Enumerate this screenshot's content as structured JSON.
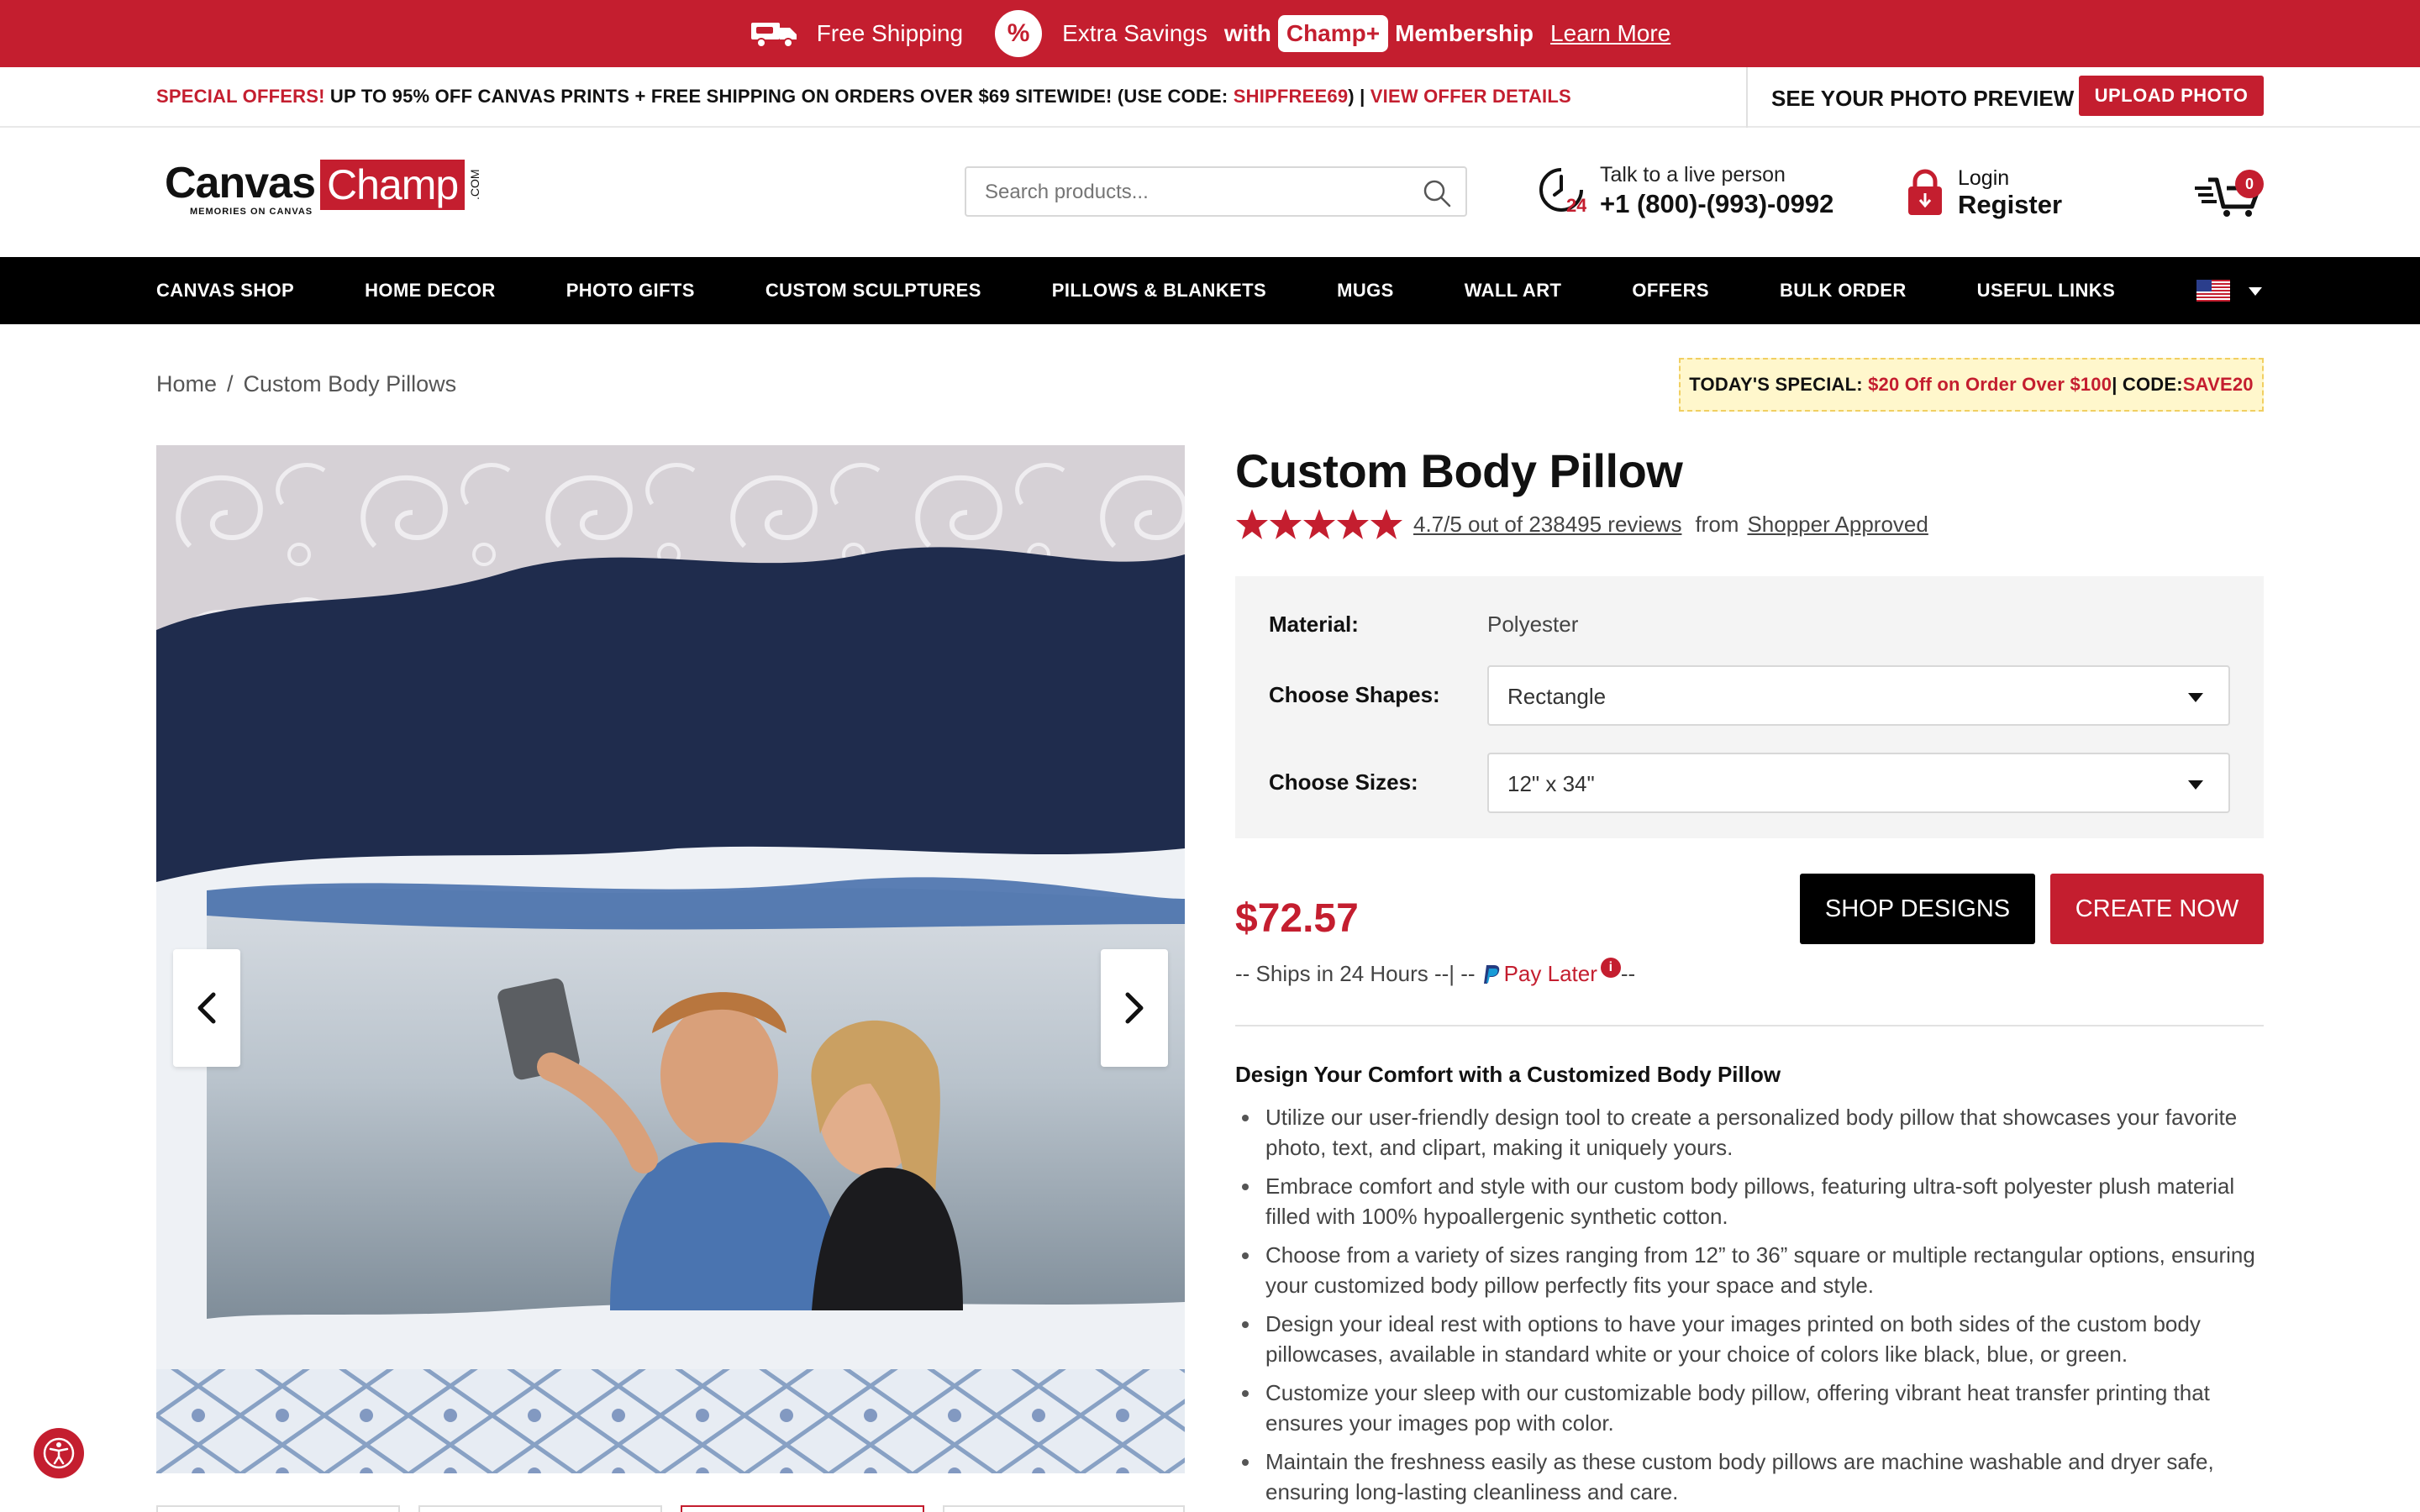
{
  "promo": {
    "free_shipping": "Free Shipping",
    "extra_savings": "Extra Savings",
    "with": "with",
    "champ_plus": "Champ+",
    "membership": "Membership",
    "learn_more": "Learn More",
    "percent_symbol": "%"
  },
  "offers": {
    "special_label": "SPECIAL OFFERS!",
    "text": " UP TO 95% OFF CANVAS PRINTS + FREE SHIPPING ON ORDERS OVER $69 SITEWIDE! (USE CODE: ",
    "code": "SHIPFREE69",
    "close_paren": ") | ",
    "view_details": "VIEW OFFER DETAILS",
    "preview": "SEE YOUR PHOTO PREVIEW",
    "upload": "UPLOAD PHOTO"
  },
  "header": {
    "logo_canvas": "Canvas",
    "logo_champ": "Champ",
    "logo_com": ".COM",
    "logo_tagline": "MEMORIES ON CANVAS",
    "search_placeholder": "Search products...",
    "phone_label": "Talk to a live person",
    "phone_number": "+1 (800)-(993)-0992",
    "phone_badge": "24",
    "login": "Login",
    "register": "Register",
    "cart_count": "0"
  },
  "nav": {
    "items": [
      {
        "label": "CANVAS SHOP"
      },
      {
        "label": "HOME DECOR"
      },
      {
        "label": "PHOTO GIFTS"
      },
      {
        "label": "CUSTOM SCULPTURES"
      },
      {
        "label": "PILLOWS & BLANKETS"
      },
      {
        "label": "MUGS"
      },
      {
        "label": "WALL ART"
      },
      {
        "label": "OFFERS"
      },
      {
        "label": "BULK ORDER"
      },
      {
        "label": "USEFUL LINKS"
      }
    ]
  },
  "breadcrumb": {
    "home": "Home",
    "separator": "/",
    "current": "Custom Body Pillows"
  },
  "special": {
    "label": "TODAY'S SPECIAL: ",
    "offer": "$20 Off on Order Over $100",
    "code_label": "| CODE:",
    "code": "SAVE20"
  },
  "product": {
    "title": "Custom Body Pillow",
    "rating_value": 4.7,
    "rating_text": "4.7/5 out of 238495 reviews",
    "from": "from",
    "source": "Shopper Approved",
    "material_label": "Material:",
    "material_value": "Polyester",
    "shapes_label": "Choose Shapes:",
    "shapes_value": "Rectangle",
    "sizes_label": "Choose Sizes:",
    "sizes_value": "12\" x 34\"",
    "price": "$72.57",
    "shop_designs": "SHOP DESIGNS",
    "create_now": "CREATE NOW",
    "ships_text": "-- Ships in 24 Hours --| --",
    "pay_later": "Pay Later",
    "ships_end": "--",
    "desc_title": "Design Your Comfort with a Customized Body Pillow",
    "bullets": [
      "Utilize our user-friendly design tool to create a personalized body pillow that showcases your favorite photo, text, and clipart, making it uniquely yours.",
      "Embrace comfort and style with our custom body pillows, featuring ultra-soft polyester plush material filled with 100% hypoallergenic synthetic cotton.",
      "Choose from a variety of sizes ranging from 12” to 36” square or multiple rectangular options, ensuring your customized body pillow perfectly fits your space and style.",
      "Design your ideal rest with options to have your images printed on both sides of the custom body pillowcases, available in standard white or your choice of colors like black, blue, or green.",
      "Customize your sleep with our customizable body pillow, offering vibrant heat transfer printing that ensures your images pop with color.",
      "Maintain the freshness easily as these custom body pillows are machine washable and dryer safe, ensuring long-lasting cleanliness and care."
    ]
  },
  "colors": {
    "brand_red": "#c41e2f",
    "nav_black": "#000000",
    "special_bg": "#fff7cc"
  }
}
